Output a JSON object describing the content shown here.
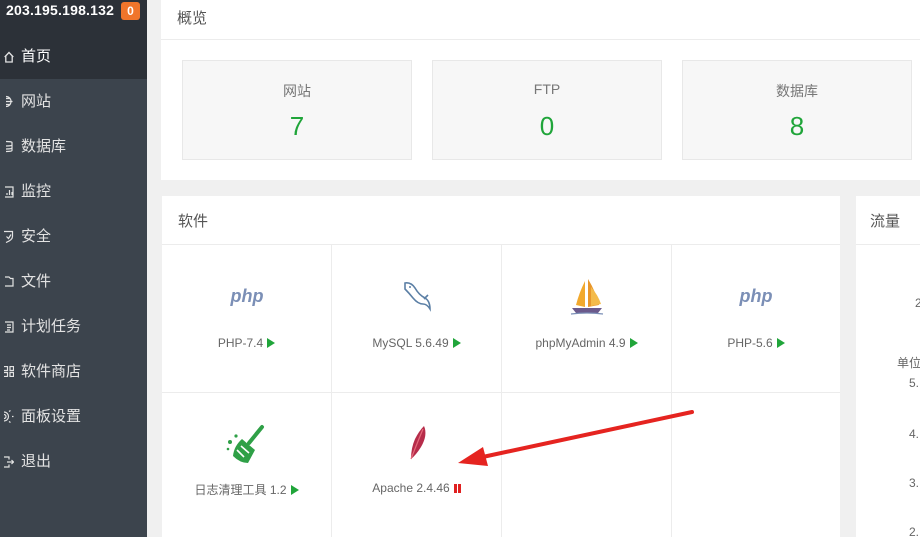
{
  "sidebar": {
    "host_ip": "203.195.198.132",
    "badge": "0",
    "items": [
      {
        "label": "首页",
        "icon": "home-icon",
        "active": true
      },
      {
        "label": "网站",
        "icon": "globe-icon"
      },
      {
        "label": "数据库",
        "icon": "database-icon"
      },
      {
        "label": "监控",
        "icon": "monitor-icon"
      },
      {
        "label": "安全",
        "icon": "shield-icon"
      },
      {
        "label": "文件",
        "icon": "folder-icon"
      },
      {
        "label": "计划任务",
        "icon": "task-icon"
      },
      {
        "label": "软件商店",
        "icon": "grid-icon"
      },
      {
        "label": "面板设置",
        "icon": "gear-icon"
      },
      {
        "label": "退出",
        "icon": "logout-icon"
      }
    ]
  },
  "overview": {
    "title": "概览",
    "stats": [
      {
        "label": "网站",
        "value": "7"
      },
      {
        "label": "FTP",
        "value": "0"
      },
      {
        "label": "数据库",
        "value": "8"
      }
    ]
  },
  "software": {
    "title": "软件",
    "items": [
      {
        "label": "PHP-7.4",
        "icon": "php-icon",
        "status": "stopped",
        "icon_text": "php"
      },
      {
        "label": "MySQL 5.6.49",
        "icon": "mysql-dolphin-icon",
        "status": "stopped"
      },
      {
        "label": "phpMyAdmin 4.9",
        "icon": "phpmyadmin-ship-icon",
        "status": "stopped"
      },
      {
        "label": "PHP-5.6",
        "icon": "php-icon",
        "status": "stopped",
        "icon_text": "php"
      },
      {
        "label": "日志清理工具 1.2",
        "icon": "broom-icon",
        "status": "stopped"
      },
      {
        "label": "Apache 2.4.46",
        "icon": "apache-feather-icon",
        "status": "running"
      }
    ]
  },
  "traffic": {
    "title": "流量",
    "partial_texts": [
      "2",
      "单位",
      "5.",
      "4.",
      "3.",
      "2."
    ]
  },
  "colors": {
    "sidebar_bg": "#3c444d",
    "sidebar_active": "#2c3138",
    "accent_green": "#20a53a",
    "badge_orange": "#f0752b",
    "arrow_red": "#e52420"
  }
}
